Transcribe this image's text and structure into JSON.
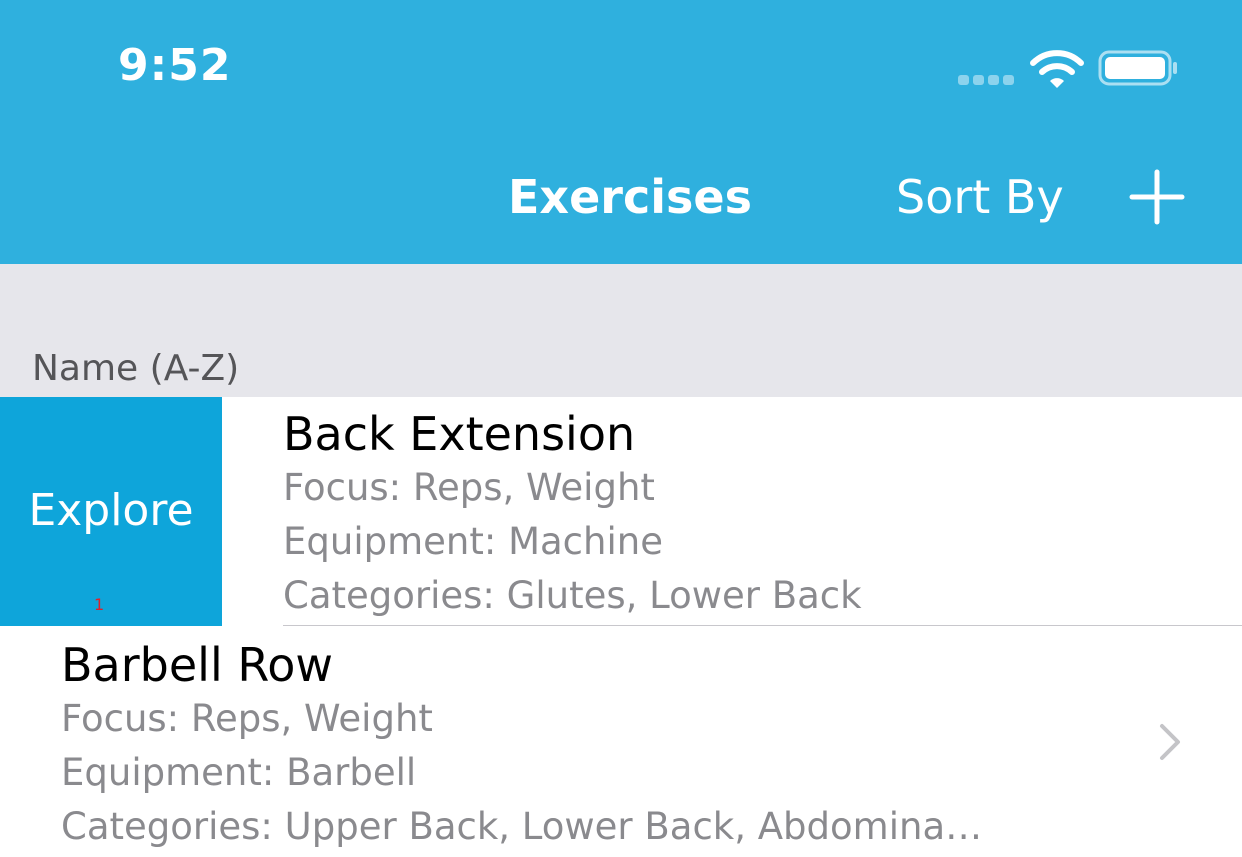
{
  "status_bar": {
    "time": "9:52"
  },
  "nav_bar": {
    "title": "Exercises",
    "sort_label": "Sort By",
    "add_icon": "plus-icon"
  },
  "section": {
    "header": "Name (A-Z)"
  },
  "rows": [
    {
      "title": "Back Extension",
      "focus": "Focus: Reps, Weight",
      "equipment": "Equipment: Machine",
      "categories": "Categories: Glutes, Lower Back",
      "swipe_action": "Explore",
      "swipe_badge": "1"
    },
    {
      "title": "Barbell Row",
      "focus": "Focus: Reps, Weight",
      "equipment": "Equipment: Barbell",
      "categories": "Categories: Upper Back, Lower Back, Abdomina…"
    }
  ],
  "colors": {
    "nav_background": "#2fb0de",
    "swipe_action_background": "#0ea5da",
    "section_background": "#e6e6eb"
  }
}
